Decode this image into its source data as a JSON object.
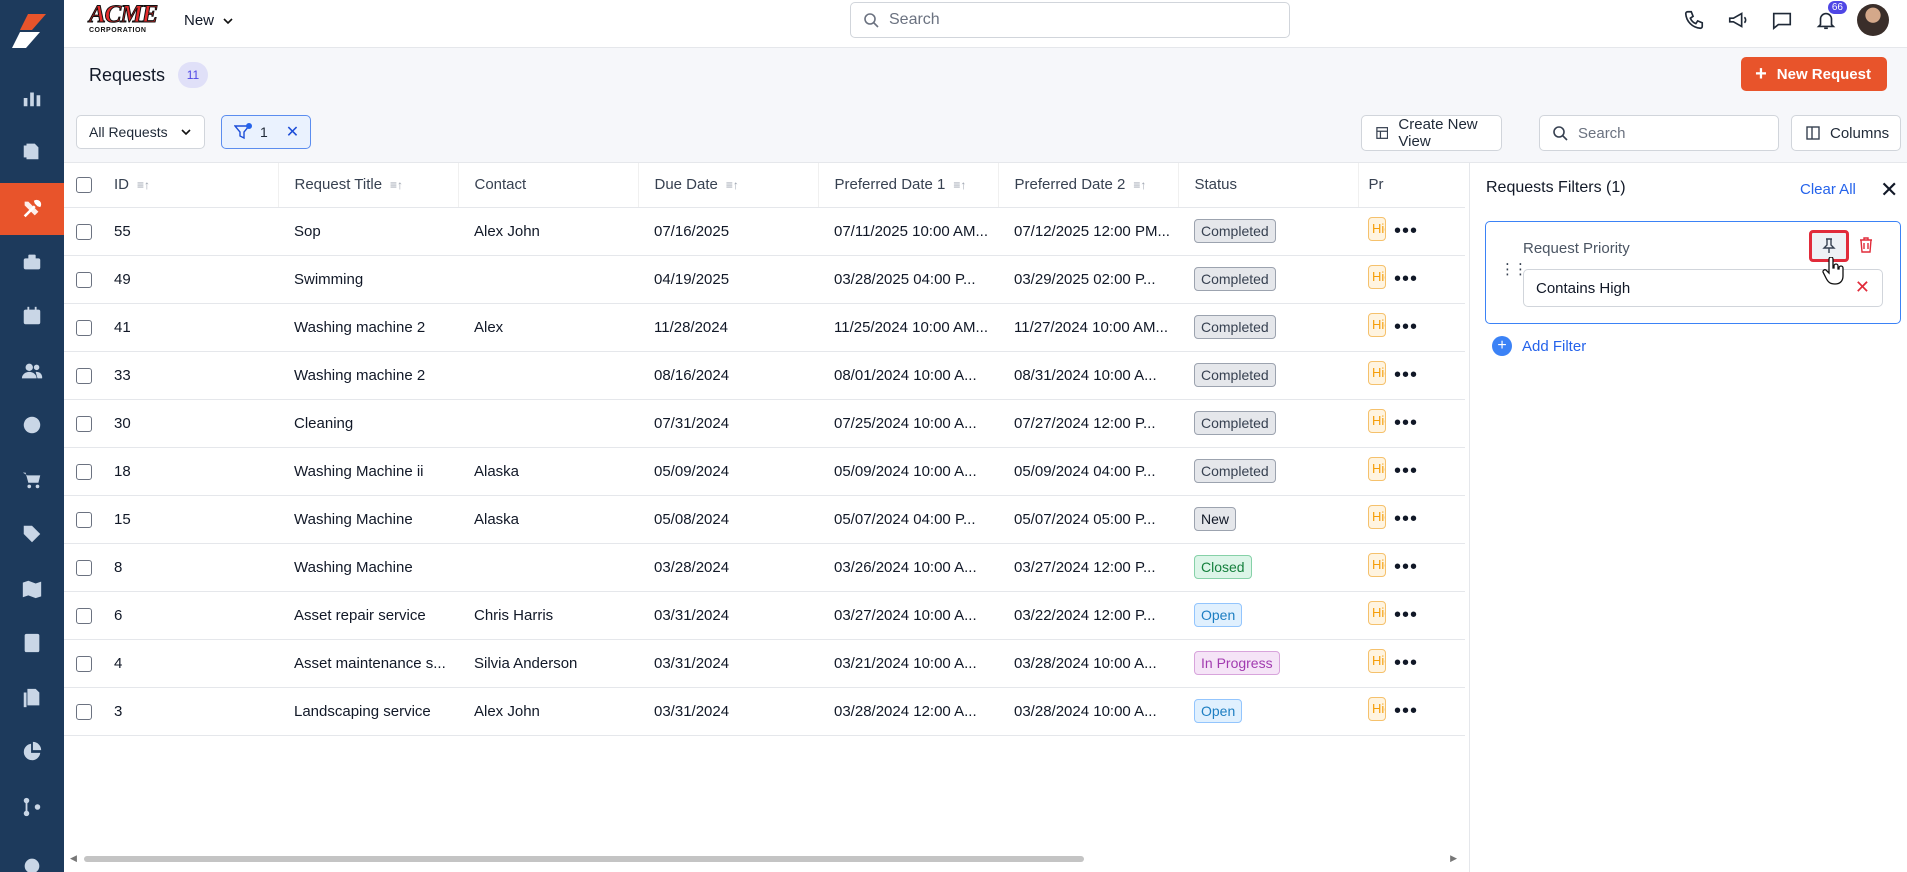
{
  "brand": {
    "name": "ACME",
    "tag": "CORPORATION"
  },
  "topbar": {
    "new_label": "New",
    "search_placeholder": "Search",
    "notif_count": "66"
  },
  "header": {
    "title": "Requests",
    "count": "11",
    "new_request_label": "New Request"
  },
  "toolbar": {
    "view_label": "All Requests",
    "filter_count": "1",
    "create_view_label": "Create New View",
    "search_placeholder": "Search",
    "columns_label": "Columns"
  },
  "table": {
    "headers": {
      "id": "ID",
      "title": "Request Title",
      "contact": "Contact",
      "due": "Due Date",
      "pref1": "Preferred Date 1",
      "pref2": "Preferred Date 2",
      "status": "Status",
      "priority": "Pr"
    },
    "rows": [
      {
        "id": "55",
        "title": "Sop",
        "contact": "Alex John",
        "due": "07/16/2025",
        "pref1": "07/11/2025 10:00 AM...",
        "pref2": "07/12/2025 12:00 PM...",
        "status": "Completed",
        "status_kind": "completed",
        "priority": "High"
      },
      {
        "id": "49",
        "title": "Swimming",
        "contact": "",
        "due": "04/19/2025",
        "pref1": "03/28/2025 04:00 P...",
        "pref2": "03/29/2025 02:00 P...",
        "status": "Completed",
        "status_kind": "completed",
        "priority": "High"
      },
      {
        "id": "41",
        "title": "Washing machine 2",
        "contact": "Alex",
        "due": "11/28/2024",
        "pref1": "11/25/2024 10:00 AM...",
        "pref2": "11/27/2024 10:00 AM...",
        "status": "Completed",
        "status_kind": "completed",
        "priority": "High"
      },
      {
        "id": "33",
        "title": "Washing machine 2",
        "contact": "",
        "due": "08/16/2024",
        "pref1": "08/01/2024 10:00 A...",
        "pref2": "08/31/2024 10:00 A...",
        "status": "Completed",
        "status_kind": "completed",
        "priority": "High"
      },
      {
        "id": "30",
        "title": "Cleaning",
        "contact": "",
        "due": "07/31/2024",
        "pref1": "07/25/2024 10:00 A...",
        "pref2": "07/27/2024 12:00 P...",
        "status": "Completed",
        "status_kind": "completed",
        "priority": "High"
      },
      {
        "id": "18",
        "title": "Washing Machine ii",
        "contact": "Alaska",
        "due": "05/09/2024",
        "pref1": "05/09/2024 10:00 A...",
        "pref2": "05/09/2024 04:00 P...",
        "status": "Completed",
        "status_kind": "completed",
        "priority": "High"
      },
      {
        "id": "15",
        "title": "Washing Machine",
        "contact": "Alaska",
        "due": "05/08/2024",
        "pref1": "05/07/2024 04:00 P...",
        "pref2": "05/07/2024 05:00 P...",
        "status": "New",
        "status_kind": "new",
        "priority": "High"
      },
      {
        "id": "8",
        "title": "Washing Machine",
        "contact": "",
        "due": "03/28/2024",
        "pref1": "03/26/2024 10:00 A...",
        "pref2": "03/27/2024 12:00 P...",
        "status": "Closed",
        "status_kind": "closed",
        "priority": "High"
      },
      {
        "id": "6",
        "title": "Asset repair service",
        "contact": "Chris Harris",
        "due": "03/31/2024",
        "pref1": "03/27/2024 10:00 A...",
        "pref2": "03/22/2024 12:00 P...",
        "status": "Open",
        "status_kind": "open",
        "priority": "High"
      },
      {
        "id": "4",
        "title": "Asset maintenance s...",
        "contact": "Silvia Anderson",
        "due": "03/31/2024",
        "pref1": "03/21/2024 10:00 A...",
        "pref2": "03/28/2024 10:00 A...",
        "status": "In Progress",
        "status_kind": "progress",
        "priority": "High"
      },
      {
        "id": "3",
        "title": "Landscaping service",
        "contact": "Alex John",
        "due": "03/31/2024",
        "pref1": "03/28/2024 12:00 A...",
        "pref2": "03/28/2024 10:00 A...",
        "status": "Open",
        "status_kind": "open",
        "priority": "High"
      }
    ]
  },
  "filter_panel": {
    "title": "Requests Filters (1)",
    "clear_all": "Clear All",
    "filter_label": "Request Priority",
    "filter_value": "Contains High",
    "add_filter": "Add Filter"
  },
  "colors": {
    "accent": "#e8542b",
    "sidebar": "#1d3a5c",
    "link": "#2563eb"
  }
}
